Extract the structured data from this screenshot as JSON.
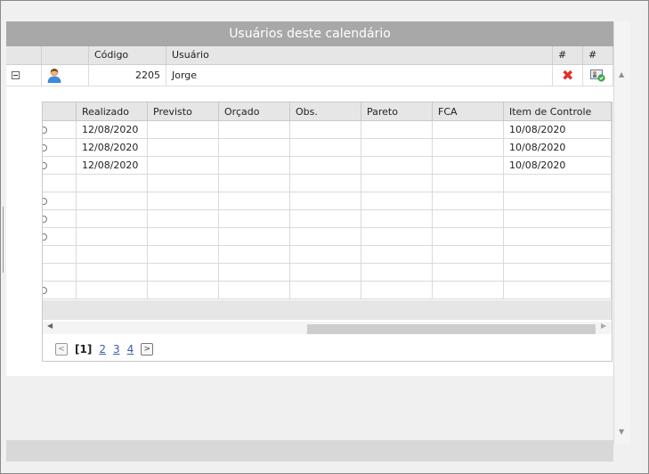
{
  "window": {
    "title": "Usuários deste calendário"
  },
  "users_table": {
    "headers": {
      "codigo": "Código",
      "usuario": "Usuário",
      "hash1": "#",
      "hash2": "#"
    },
    "row": {
      "codigo": "2205",
      "usuario": "Jorge",
      "user_icon": "user-avatar-icon",
      "delete_icon": "delete-x-icon",
      "permission_icon": "user-permission-icon"
    }
  },
  "detail_table": {
    "headers": [
      "Realizado",
      "Previsto",
      "Orçado",
      "Obs.",
      "Pareto",
      "FCA",
      "Item de Controle"
    ],
    "rows": [
      {
        "realizado": "12/08/2020",
        "item": "10/08/2020"
      },
      {
        "realizado": "12/08/2020",
        "item": "10/08/2020"
      },
      {
        "realizado": "12/08/2020",
        "item": "10/08/2020"
      },
      {
        "realizado": "",
        "item": ""
      },
      {
        "realizado": "",
        "item": ""
      },
      {
        "realizado": "",
        "item": ""
      },
      {
        "realizado": "",
        "item": ""
      },
      {
        "realizado": "",
        "item": ""
      },
      {
        "realizado": "",
        "item": ""
      },
      {
        "realizado": "",
        "item": ""
      }
    ]
  },
  "pager": {
    "current": "[1]",
    "pages": [
      "2",
      "3",
      "4"
    ],
    "prev": "<",
    "next": ">"
  }
}
